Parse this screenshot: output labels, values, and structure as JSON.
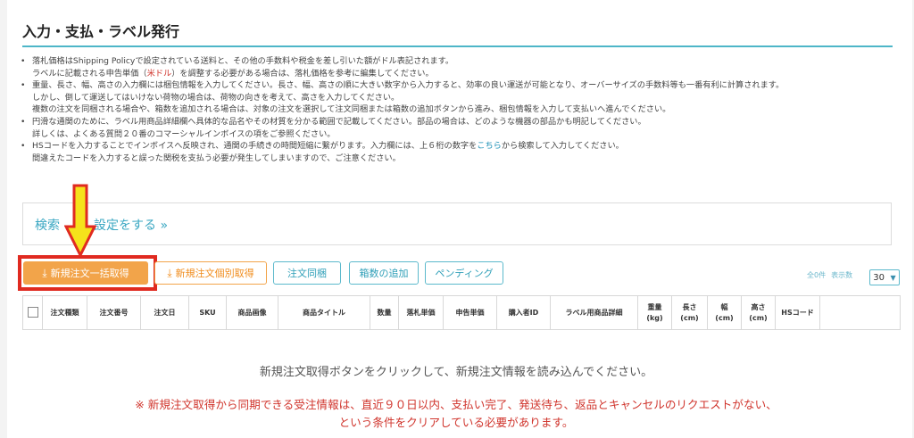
{
  "page": {
    "title": "入力・支払・ラベル発行"
  },
  "notes": [
    {
      "lines": [
        {
          "parts": [
            "落札価格はShipping Policyで設定されている送料と、その他の手数料や税金を差し引いた額がドル表記されます。"
          ]
        },
        {
          "parts": [
            "ラベルに記載される申告単価（",
            "米ドル",
            "）を調整する必要がある場合は、落札価格を参考に編集してください。"
          ]
        }
      ]
    },
    {
      "lines": [
        {
          "parts": [
            "重量、長さ、幅、高さの入力欄には梱包情報を入力してください。長さ、幅、高さの順に大きい数字から入力すると、効率の良い運送が可能となり、オーバーサイズの手数料等も一番有利に計算されます。"
          ]
        },
        {
          "parts": [
            "しかし、倒して運送してはいけない荷物の場合は、荷物の向きを考えて、高さを入力してください。"
          ]
        },
        {
          "parts": [
            "複数の注文を同梱される場合や、箱数を追加される場合は、対象の注文を選択して注文同梱または箱数の追加ボタンから進み、梱包情報を入力して支払いへ進んでください。"
          ]
        }
      ]
    },
    {
      "lines": [
        {
          "parts": [
            "円滑な通関のために、ラベル用商品詳細欄へ具体的な品名やその材質を分かる範囲で記載してください。部品の場合は、どのような機器の部品かも明記してください。"
          ]
        },
        {
          "parts": [
            "詳しくは、よくある質問２０番のコマーシャルインボイスの項をご参照ください。"
          ]
        }
      ]
    },
    {
      "lines": [
        {
          "parts": [
            "HSコードを入力することでインボイスへ反映され、通関の手続きの時間短縮に繋がります。入力欄には、上６桁の数字を",
            "こちら",
            "から検索して入力してください。"
          ]
        },
        {
          "parts": [
            "間違えたコードを入力すると誤った関税を支払う必要が発生してしまいますので、ご注意ください。"
          ]
        }
      ]
    }
  ],
  "search": {
    "link_label": "検索",
    "link_label_rest": "設定をする »"
  },
  "toolbar": {
    "bulk_fetch_label": "新規注文一括取得",
    "single_fetch_label": "新規注文個別取得",
    "bundle_label": "注文同梱",
    "add_box_label": "箱数の追加",
    "pending_label": "ペンディング"
  },
  "paging": {
    "total_label": "全0件",
    "per_page_label": "表示数",
    "per_page_value": "30"
  },
  "table": {
    "columns": [
      "注文種類",
      "注文番号",
      "注文日",
      "SKU",
      "商品画像",
      "商品タイトル",
      "数量",
      "落札単価",
      "申告単価",
      "購入者ID",
      "ラベル用商品詳細",
      "重量\n(kg)",
      "長さ\n(cm)",
      "幅\n(cm)",
      "高さ\n(cm)",
      "HSコード",
      ""
    ]
  },
  "empty_state": {
    "message": "新規注文取得ボタンをクリックして、新規注文情報を読み込んでください。",
    "warning_line1": "※ 新規注文取得から同期できる受注情報は、直近９０日以内、支払い完了、発送待ち、返品とキャンセルのリクエストがない、",
    "warning_line2": "という条件をクリアしている必要があります。"
  },
  "colors": {
    "accent_teal": "#4db6c8",
    "orange": "#f2a44a",
    "highlight_red": "#e02a20",
    "arrow_yellow": "#f5e21b",
    "warning_red": "#d0342c"
  }
}
